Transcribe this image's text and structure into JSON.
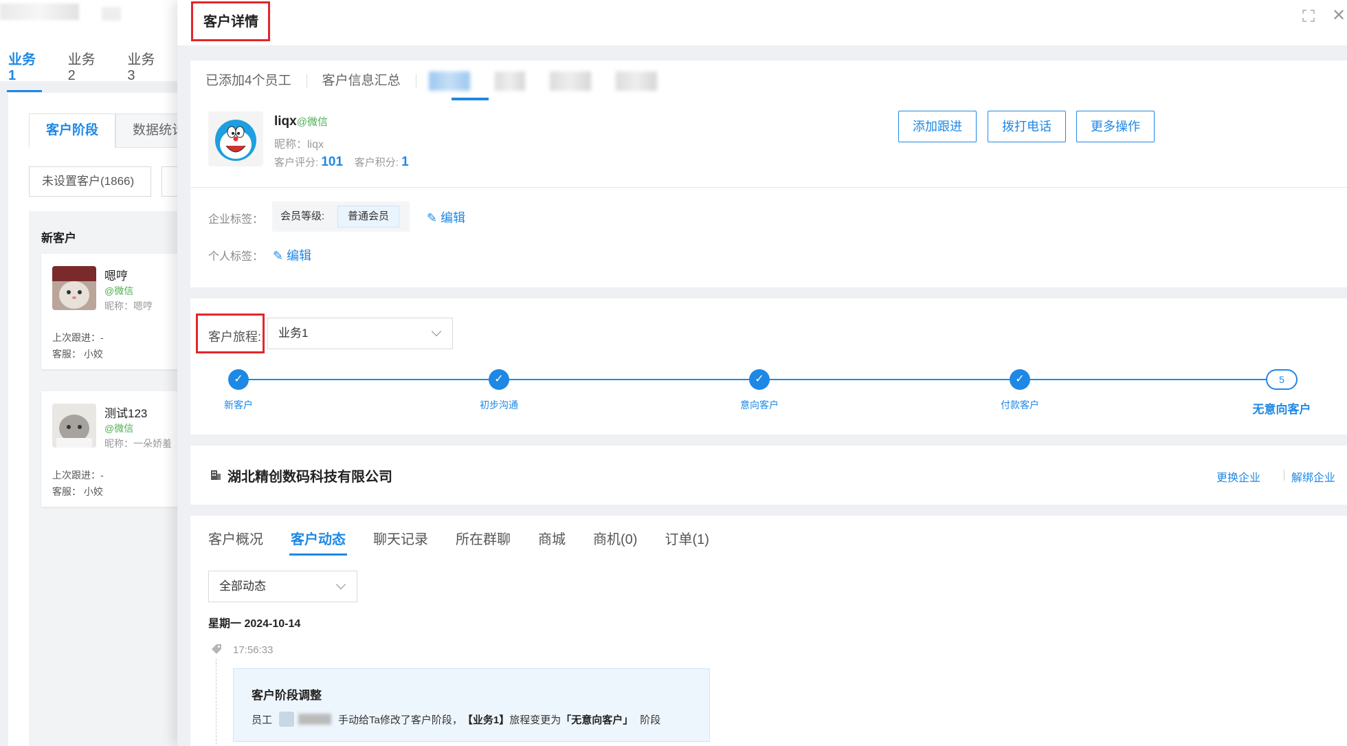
{
  "background_page": {
    "tabs": [
      "业务1",
      "业务2",
      "业务3"
    ],
    "subtabs": [
      "客户阶段",
      "数据统计"
    ],
    "filter_label": "未设置客户(1866)",
    "column_title": "新客户",
    "customers": [
      {
        "name": "嗯哼",
        "channel": "@微信",
        "nickname": "昵称：嗯哼",
        "last_follow": "上次跟进：-",
        "service": "客服：  小姣"
      },
      {
        "name": "测试123",
        "channel": "@微信",
        "nickname": "昵称：一朵娇羞",
        "last_follow": "上次跟进：-",
        "service": "客服：  小姣"
      }
    ]
  },
  "drawer": {
    "title": "客户详情",
    "profile_tabs": [
      "已添加4个员工",
      "客户信息汇总"
    ],
    "customer": {
      "name": "liqx",
      "channel": "@微信",
      "nickname": "昵称：liqx",
      "score_label": "客户评分:",
      "score": "101",
      "points_label": "客户积分:",
      "points": "1"
    },
    "actions": [
      "添加跟进",
      "拨打电话",
      "更多操作"
    ],
    "enterprise_tags_label": "企业标签：",
    "member_level_label": "会员等级:",
    "member_level": "普通会员",
    "personal_tags_label": "个人标签：",
    "edit_label": "编辑",
    "journey": {
      "label": "客户旅程:",
      "selected": "业务1",
      "steps": [
        "新客户",
        "初步沟通",
        "意向客户",
        "付款客户",
        "无意向客户"
      ],
      "current_step_number": "5"
    },
    "company": {
      "name": "湖北精创数码科技有限公司",
      "change_label": "更换企业",
      "unbind_label": "解绑企业"
    },
    "detail_tabs": [
      "客户概况",
      "客户动态",
      "聊天记录",
      "所在群聊",
      "商城",
      "商机(0)",
      "订单(1)"
    ],
    "active_detail_tab": "客户动态",
    "dynamics_filter": "全部动态",
    "timeline": {
      "date": "星期一 2024-10-14",
      "time": "17:56:33",
      "event_title": "客户阶段调整",
      "event_prefix": "员工",
      "event_action": "手动给Ta修改了客户阶段，",
      "event_journey": "【业务1】",
      "event_change": "旅程变更为",
      "event_stage": "「无意向客户」",
      "event_suffix": "阶段"
    }
  },
  "colors": {
    "accent": "#1e88e5",
    "highlight_border": "#e0262b",
    "wechat_green": "#4caf50"
  }
}
